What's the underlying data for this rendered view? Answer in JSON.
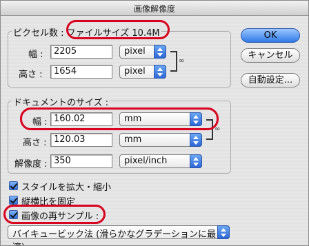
{
  "window": {
    "title": "画像解像度"
  },
  "pixel_dimensions": {
    "legend_prefix": "ピクセル数 : ",
    "legend_size": "ファイルサイズ 10.4M",
    "width": {
      "label": "幅 :",
      "value": "2205",
      "unit": "pixel"
    },
    "height": {
      "label": "高さ :",
      "value": "1654",
      "unit": "pixel"
    }
  },
  "document_size": {
    "legend": "ドキュメントのサイズ :",
    "width": {
      "label": "幅 :",
      "value": "160.02",
      "unit": "mm"
    },
    "height": {
      "label": "高さ :",
      "value": "120.03",
      "unit": "mm"
    },
    "resolution": {
      "label": "解像度 :",
      "value": "350",
      "unit": "pixel/inch"
    }
  },
  "options": {
    "scale_styles": {
      "label": "スタイルを拡大・縮小",
      "checked": true
    },
    "constrain_proportions": {
      "label": "縦横比を固定",
      "checked": true
    },
    "resample": {
      "label": "画像の再サンプル :",
      "checked": true
    },
    "resample_method": "バイキュービック法 (滑らかなグラデーションに最適)"
  },
  "buttons": {
    "ok": "OK",
    "cancel": "キャンセル",
    "auto": "自動設定..."
  },
  "icons": {
    "link": "chain-link-icon",
    "popup_arrows": "updown-arrows-icon",
    "check": "checkmark-icon"
  },
  "colors": {
    "highlight": "#d8001e",
    "accent": "#2f79e6"
  }
}
